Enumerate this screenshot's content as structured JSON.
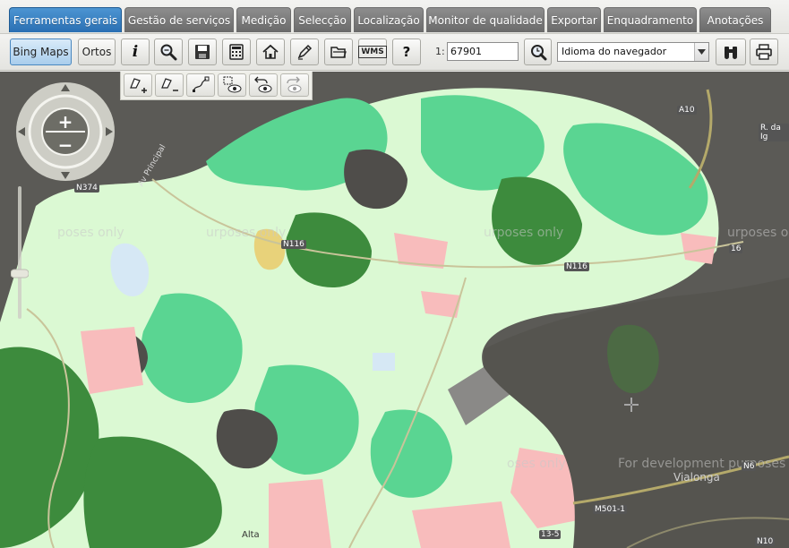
{
  "tabs": [
    {
      "label": "Ferramentas gerais",
      "active": true
    },
    {
      "label": "Gestão de serviços",
      "active": false
    },
    {
      "label": "Medição",
      "active": false
    },
    {
      "label": "Selecção",
      "active": false
    },
    {
      "label": "Localização",
      "active": false
    },
    {
      "label": "Monitor de qualidade",
      "active": false
    },
    {
      "label": "Exportar",
      "active": false
    },
    {
      "label": "Enquadramento",
      "active": false
    },
    {
      "label": "Anotações",
      "active": false
    }
  ],
  "toolbar": {
    "bing_maps_label": "Bing Maps",
    "ortos_label": "Ortos",
    "scale_prefix": "1:",
    "scale_value": "67901",
    "language_selected": "Idioma do navegador",
    "icons": [
      "info-icon",
      "zoom-search-icon",
      "save-icon",
      "calculator-icon",
      "home-icon",
      "pen-icon",
      "folder-icon",
      "wms-icon",
      "help-icon",
      "scale-zoom-icon",
      "binoculars-icon",
      "print-icon"
    ],
    "wms_text": "WMS",
    "help_text": "?",
    "info_text": "i"
  },
  "edit_toolbar": {
    "icons": [
      "add-polygon-icon",
      "remove-polygon-icon",
      "draw-line-icon",
      "select-view-icon",
      "undo-view-icon",
      "redo-view-icon"
    ]
  },
  "navigation": {
    "zoom_in_label": "+",
    "zoom_out_label": "−"
  },
  "map": {
    "watermarks": [
      "poses only",
      "urposes only",
      "urposes only",
      "urposes o",
      "oses only",
      "For development purposes o"
    ],
    "road_labels": [
      "N374",
      "N116",
      "A10",
      "N116",
      "16",
      "M501-1",
      "N10",
      "13-5",
      "R. da Ig",
      "N6",
      "Av Principal"
    ],
    "place_labels": [
      "Vialonga",
      "Alta"
    ]
  },
  "colors": {
    "tab_active": "#2a6fb3",
    "tab_inactive": "#7a7a7a",
    "map_base": "#5a5a55",
    "land_pale_green": "#d8f8d0",
    "land_mint": "#5fd896",
    "land_dark_green": "#3c8c3c",
    "land_pink": "#f7bcbc",
    "land_dark_gray": "#4f4d4a"
  }
}
